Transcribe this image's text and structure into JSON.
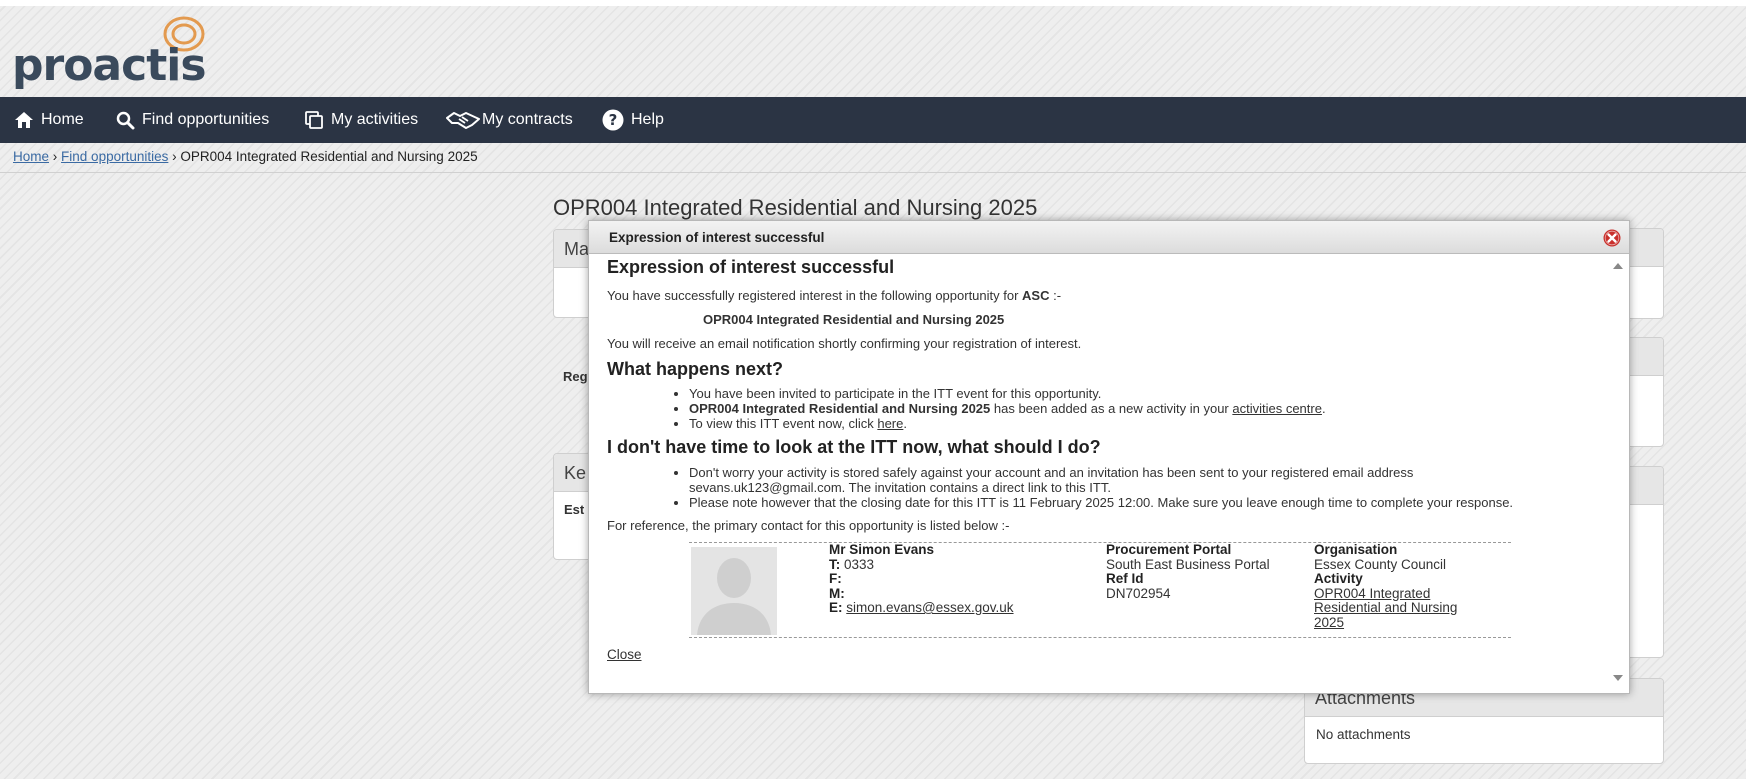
{
  "brand": {
    "name": "proactis",
    "accent": "#e39a4f"
  },
  "nav": [
    {
      "label": "Home",
      "icon": "home-icon"
    },
    {
      "label": "Find opportunities",
      "icon": "search-icon"
    },
    {
      "label": "My activities",
      "icon": "copy-icon"
    },
    {
      "label": "My contracts",
      "icon": "handshake-icon"
    },
    {
      "label": "Help",
      "icon": "help-icon"
    }
  ],
  "breadcrumb": {
    "home": "Home",
    "find": "Find opportunities",
    "separator": "›",
    "current": "OPR004 Integrated Residential and Nursing 2025"
  },
  "page": {
    "title": "OPR004 Integrated Residential and Nursing 2025",
    "panel_partials": [
      "Ma",
      "Reg",
      "Ke",
      "Est"
    ],
    "attachments": {
      "title": "Attachments",
      "empty": "No attachments"
    }
  },
  "modal": {
    "header": "Expression of interest successful",
    "heading": "Expression of interest successful",
    "intro_pre": "You have successfully registered interest in the following opportunity for ",
    "intro_org": "ASC",
    "intro_post": " :-",
    "opportunity": "OPR004 Integrated Residential and Nursing 2025",
    "email_note": "You will receive an email notification shortly confirming your registration of interest.",
    "next_heading": "What happens next?",
    "next_1": "You have been invited to participate in the ITT event for this opportunity.",
    "next_2_bold": "OPR004 Integrated Residential and Nursing 2025",
    "next_2_text": " has been added as a new activity in your ",
    "next_2_link": "activities centre",
    "next_2_end": ".",
    "next_3_text": "To view this ITT event now, click ",
    "next_3_link": "here",
    "next_3_end": ".",
    "time_heading": "I don't have time to look at the ITT now, what should I do?",
    "time_1": "Don't worry your activity is stored safely against your account and an invitation has been sent to your registered email address sevans.uk123@gmail.com. The invitation contains a direct link to this ITT.",
    "time_2": "Please note however that the closing date for this ITT is 11 February 2025 12:00. Make sure you leave enough time to complete your response.",
    "ref_intro": "For reference, the primary contact for this opportunity is listed below :-",
    "contact": {
      "name": "Mr Simon Evans",
      "t_label": "T:",
      "t_value": " 0333",
      "f_label": "F:",
      "m_label": "M:",
      "e_label": "E:",
      "e_value": "simon.evans@essex.gov.uk"
    },
    "portal": {
      "label": "Procurement Portal",
      "value": "South East Business Portal",
      "ref_label": "Ref Id",
      "ref_value": "DN702954"
    },
    "org": {
      "label": "Organisation",
      "value": "Essex County Council",
      "activity_label": "Activity",
      "activity_value": "OPR004 Integrated Residential and Nursing 2025"
    },
    "close": "Close"
  },
  "colors": {
    "navbar": "#2b3444",
    "link": "#3a6aa3",
    "close_red": "#c9302c"
  }
}
